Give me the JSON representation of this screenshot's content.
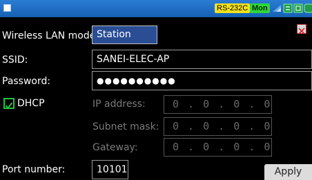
{
  "status_bar": {
    "interface_badge": "RS-232C",
    "mode_badge": "Mon"
  },
  "form": {
    "wireless_mode": {
      "label": "Wireless LAN mode:",
      "value": "Station"
    },
    "ssid": {
      "label": "SSID:",
      "value": "SANEI-ELEC-AP"
    },
    "password": {
      "label": "Password:",
      "value": "●●●●●●●●●●"
    },
    "dhcp": {
      "label": "DHCP",
      "checked": true
    },
    "ip_address": {
      "label": "IP address:",
      "value": "0 . 0 . 0 . 0"
    },
    "subnet_mask": {
      "label": "Subnet mask:",
      "value": "0 . 0 . 0 . 0"
    },
    "gateway": {
      "label": "Gateway:",
      "value": "0 . 0 . 0 . 0"
    },
    "port": {
      "label": "Port number:",
      "value": "10101"
    }
  },
  "buttons": {
    "apply": "Apply"
  },
  "colors": {
    "title_bar": "#1f6fc6",
    "selected_field": "#2a4d93",
    "checkbox": "#21c43a",
    "mon_badge": "#31d63a",
    "rs_badge": "#f3e11b"
  }
}
